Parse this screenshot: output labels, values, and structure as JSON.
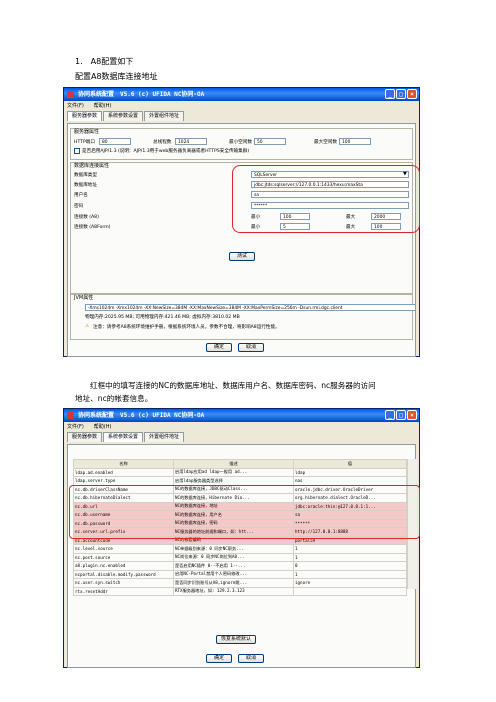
{
  "doc": {
    "step1": "1.　A8配置如下",
    "step1_sub": "配置A8数据库连接地址",
    "para_line1": "红框中的填写连接的NC的数据库地址、数据库用户名、数据库密码、nc服务器的访问",
    "para_line2": "地址、nc的帐套信息。"
  },
  "win1": {
    "title": "协同系统配置　V5.6 (c) UFIDA NC协同-OA",
    "menu": [
      "文件(F)",
      "帮助(H)"
    ],
    "tabs": [
      "服务器参数",
      "系统参数设置",
      "外置组件地址"
    ],
    "server_group": "服务器属性",
    "http_port_label": "HTTP端口",
    "http_port": "80",
    "total_threads_label": "总线程数",
    "total_threads": "1024",
    "min_idle_label": "最小空闲数",
    "min_idle": "50",
    "max_idle_label": "最大空闲数",
    "max_idle": "100",
    "ajp_label": "是否启用AJP/1.3 (说明：AJP/1.3用于web服务器负离器或者HTTPS安全传输集群)",
    "db_group": "数据库连接属性",
    "db_type_label": "数据库类型",
    "db_type": "SQLServer",
    "db_addr_label": "数据库地址",
    "db_addr": "jdbc:jtds:sqlserver://127.0.0.1:1433/hexu;maxSta",
    "user_label": "用户名",
    "user": "sa",
    "pwd_label": "密码",
    "pwd": "******",
    "conn_a8_label": "连接数 (A8)",
    "conn_a8_min_label": "最小",
    "conn_a8_min": "100",
    "conn_a8_max_label": "最大",
    "conn_a8_max": "2000",
    "conn_form_label": "连接数 (A8Form)",
    "conn_form_min_label": "最小",
    "conn_form_min": "5",
    "conn_form_max_label": "最大",
    "conn_form_max": "100",
    "test_button": "测试",
    "jvm_group": "JVM属性",
    "jvm_value": "-Xms1024m -Xmx1024m -XX:NewSize=384M -XX:MaxNewSize=384M -XX:MaxPermSize=256m -Dsun.rmi.dgc.client",
    "mem_info": "物理内存:2025.95 MB; 可用物理内存:421.46 MB; 虚拟内存:3810.02 MB",
    "note": "注意：请参考A8系统环境维护手册，根据系统环境人员，参数不合理，将影响A8运行性能。",
    "ok": "确定",
    "cancel": "取消"
  },
  "win2": {
    "title": "协同系统配置　V5.6 (c) UFIDA NC协同-OA",
    "menu": [
      "文件(F)",
      "帮助(H)"
    ],
    "tabs": [
      "服务器参数",
      "系统参数设置",
      "外置组件地址"
    ],
    "headers": [
      "名称",
      "描述",
      "值"
    ],
    "rows": [
      {
        "name": "ldap.ad.enabled",
        "desc": "启用ldap应用ad ldap一般用 ad...",
        "value": "ldap"
      },
      {
        "name": "ldap.server.type",
        "desc": "启用ldap服务器类型选择",
        "value": "nas"
      },
      {
        "name": "nc.db.driverClassName",
        "desc": "NC的数据库连接，JDBC驱动Class...",
        "value": "oracle.jdbc.driver.OracleDriver"
      },
      {
        "name": "nc.db.hibernateDialect",
        "desc": "NC的数据库连接，Hibernate Dia...",
        "value": "org.hibernate.dialect.OracleD..."
      },
      {
        "name": "nc.db.url",
        "desc": "NC的数据库连接，地址",
        "value": "jdbc:oracle:thin:@127.0.0.1:1..."
      },
      {
        "name": "nc.db.username",
        "desc": "NC的数据库连接，用户名",
        "value": "sa"
      },
      {
        "name": "nc.db.password",
        "desc": "NC的数据库连接，密码",
        "value": "******"
      },
      {
        "name": "nc.server.url.prefix",
        "desc": "NC服务器的地址前缀和端口，如：htt...",
        "value": "http://127.0.0.1:8888"
      },
      {
        "name": "nc.accountcode",
        "desc": "NC的帐套编码",
        "value": "portal59"
      },
      {
        "name": "nc.level.source",
        "desc": "NC单据级别来源：0 同步NC职务...",
        "value": "1"
      },
      {
        "name": "nc.post.source",
        "desc": "NC岗位来源：0 同步NC岗位到A8...",
        "value": "1"
      },
      {
        "name": "a8.plugin.nc.enabled",
        "desc": "是否启用NC插件 0--不启用 1--...",
        "value": "0"
      },
      {
        "name": "ncportal.disable.modify.password",
        "desc": "启用NC-Portal禁用个人密码修改...",
        "value": "1"
      },
      {
        "name": "nc.user.syn.switch",
        "desc": "是否同步识别账号从A8,ignore跳...",
        "value": "ignore"
      },
      {
        "name": "rtx.resetAddr",
        "desc": "RTX服务器地址，如: 129.2.3.123",
        "value": ""
      }
    ],
    "restore_button": "恢复系统默认",
    "ok": "确定",
    "cancel": "取消"
  },
  "colors": {
    "highlight": "#f6c9c9",
    "redbox": "#e0242a",
    "titlebar": "#0058e6"
  }
}
